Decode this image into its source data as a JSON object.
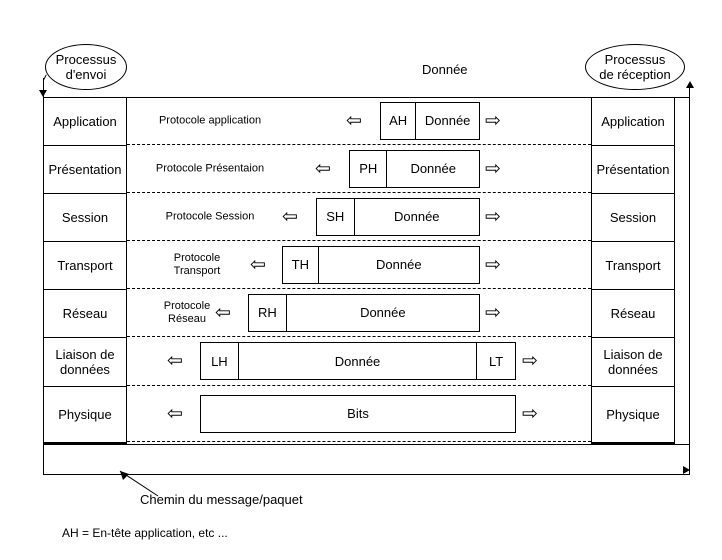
{
  "diagram": {
    "top_label": "Donnée",
    "path_caption": "Chemin du message/paquet",
    "legend_note": "AH = En-tête application, etc ..."
  },
  "endpoints": {
    "sender": {
      "line1": "Processus",
      "line2": "d'envoi"
    },
    "receiver": {
      "line1": "Processus",
      "line2": "de réception"
    }
  },
  "layers": [
    {
      "name": "Application",
      "protocol": "Protocole application",
      "arrow_left": "⇦",
      "arrow_right": "⇨"
    },
    {
      "name": "Présentation",
      "protocol": "Protocole Présentaion",
      "arrow_left": "⇦",
      "arrow_right": "⇨"
    },
    {
      "name": "Session",
      "protocol": "Protocole Session",
      "arrow_left": "⇦",
      "arrow_right": "⇨"
    },
    {
      "name": "Transport",
      "protocol": "Protocole\nTransport",
      "arrow_left": "⇦",
      "arrow_right": "⇨"
    },
    {
      "name": "Réseau",
      "protocol": "Protocole\nRéseau",
      "arrow_left": "⇦",
      "arrow_right": "⇨"
    },
    {
      "name": "Liaison de données",
      "protocol": "",
      "arrow_left": "⇦",
      "arrow_right": "⇨"
    },
    {
      "name": "Physique",
      "protocol": "",
      "arrow_left": "⇦",
      "arrow_right": "⇨"
    }
  ],
  "pdus": [
    {
      "layer": "Application",
      "segments": [
        "AH",
        "Donnée"
      ]
    },
    {
      "layer": "Présentation",
      "segments": [
        "PH",
        "Donnée"
      ]
    },
    {
      "layer": "Session",
      "segments": [
        "SH",
        "Donnée"
      ]
    },
    {
      "layer": "Transport",
      "segments": [
        "TH",
        "Donnée"
      ]
    },
    {
      "layer": "Réseau",
      "segments": [
        "RH",
        "Donnée"
      ]
    },
    {
      "layer": "Liaison de données",
      "segments": [
        "LH",
        "Donnée",
        "LT"
      ]
    },
    {
      "layer": "Physique",
      "segments": [
        "Bits"
      ]
    }
  ],
  "colors": {
    "stroke": "#000000",
    "background": "#ffffff"
  }
}
